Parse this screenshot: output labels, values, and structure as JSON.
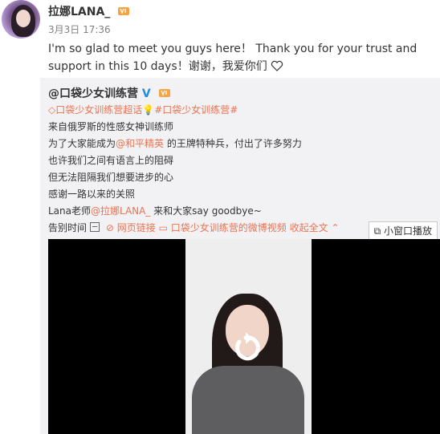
{
  "post": {
    "author": "拉娜LANA_",
    "time": "3月3日 17:36",
    "text": "I'm so glad to meet you guys here！ Thank you for your trust and support in this 10 days！谢谢，我爱你们"
  },
  "repost": {
    "author": "@口袋少女训练营",
    "tags": "口袋少女训练营超话",
    "tags2": "#口袋少女训练营#",
    "lines": [
      "来自俄罗斯的性感女神训练师",
      "为了大家能成为",
      "也许我们之间有语言上的阻碍",
      "但无法阻隔我们想要进步的心",
      "感谢一路以来的关照"
    ],
    "mention_pingjing": "@和平精英",
    "line2_tail": " 的王牌特种兵，付出了许多努力",
    "lana_prefix": "Lana老师",
    "lana_mention": "@拉娜LANA_",
    "lana_tail": " 来和大家say goodbye~",
    "meta_prefix": "告别时间",
    "web_link": "网页链接",
    "video_link": "口袋少女训练营的微博视频",
    "collapse": "收起全文",
    "popout": "小窗口播放"
  },
  "colors": {
    "link": "#eb7350",
    "verified": "#1e8fe1",
    "repost_bg": "#f2f2f5"
  },
  "icons": [
    "heart-outline-icon",
    "vip-badge-icon",
    "verified-v-icon",
    "diamond-icon",
    "collapse-icon",
    "link-icon",
    "video-icon",
    "chevron-up-icon",
    "popout-icon",
    "replay-icon"
  ]
}
